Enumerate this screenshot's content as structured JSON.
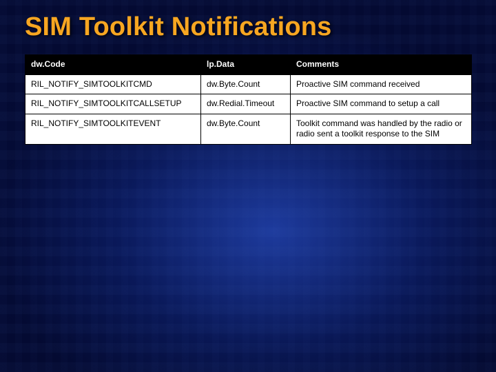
{
  "title": "SIM Toolkit Notifications",
  "table": {
    "headers": [
      "dw.Code",
      "lp.Data",
      "Comments"
    ],
    "rows": [
      {
        "code": "RIL_NOTIFY_SIMTOOLKITCMD",
        "data": "dw.Byte.Count",
        "comment": "Proactive SIM command received"
      },
      {
        "code": "RIL_NOTIFY_SIMTOOLKITCALLSETUP",
        "data": "dw.Redial.Timeout",
        "comment": "Proactive SIM command to setup a call"
      },
      {
        "code": "RIL_NOTIFY_SIMTOOLKITEVENT",
        "data": "dw.Byte.Count",
        "comment": "Toolkit command was handled by the radio or radio sent a toolkit response to the SIM"
      }
    ]
  }
}
